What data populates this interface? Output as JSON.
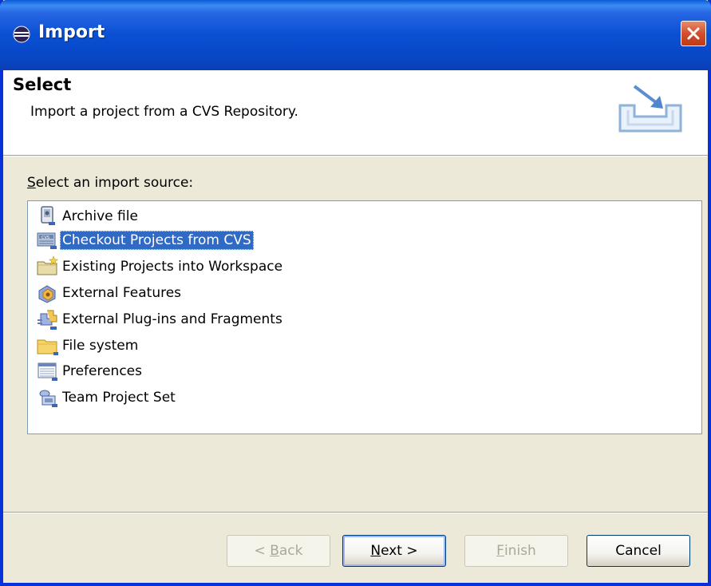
{
  "window": {
    "title": "Import",
    "title_color": "#0a4fd3"
  },
  "header": {
    "heading": "Select",
    "description": "Import a project from a CVS Repository."
  },
  "source": {
    "label_mnemonic": "S",
    "label_rest": "elect an import source:"
  },
  "list": {
    "items": [
      {
        "label": "Archive file",
        "icon": "archive-file-icon"
      },
      {
        "label": "Checkout Projects from CVS",
        "icon": "cvs-repository-icon",
        "selected": true
      },
      {
        "label": "Existing Projects into Workspace",
        "icon": "project-folder-icon"
      },
      {
        "label": "External Features",
        "icon": "feature-icon"
      },
      {
        "label": "External Plug-ins and Fragments",
        "icon": "plugin-icon"
      },
      {
        "label": "File system",
        "icon": "folder-icon"
      },
      {
        "label": "Preferences",
        "icon": "preferences-icon"
      },
      {
        "label": "Team Project Set",
        "icon": "team-project-set-icon"
      }
    ],
    "selection_color": "#316ac5"
  },
  "buttons": {
    "back_prefix": "< ",
    "back_mnemonic": "B",
    "back_rest": "ack",
    "next_mnemonic": "N",
    "next_rest": "ext >",
    "finish_mnemonic": "F",
    "finish_rest": "inish",
    "cancel": "Cancel"
  }
}
